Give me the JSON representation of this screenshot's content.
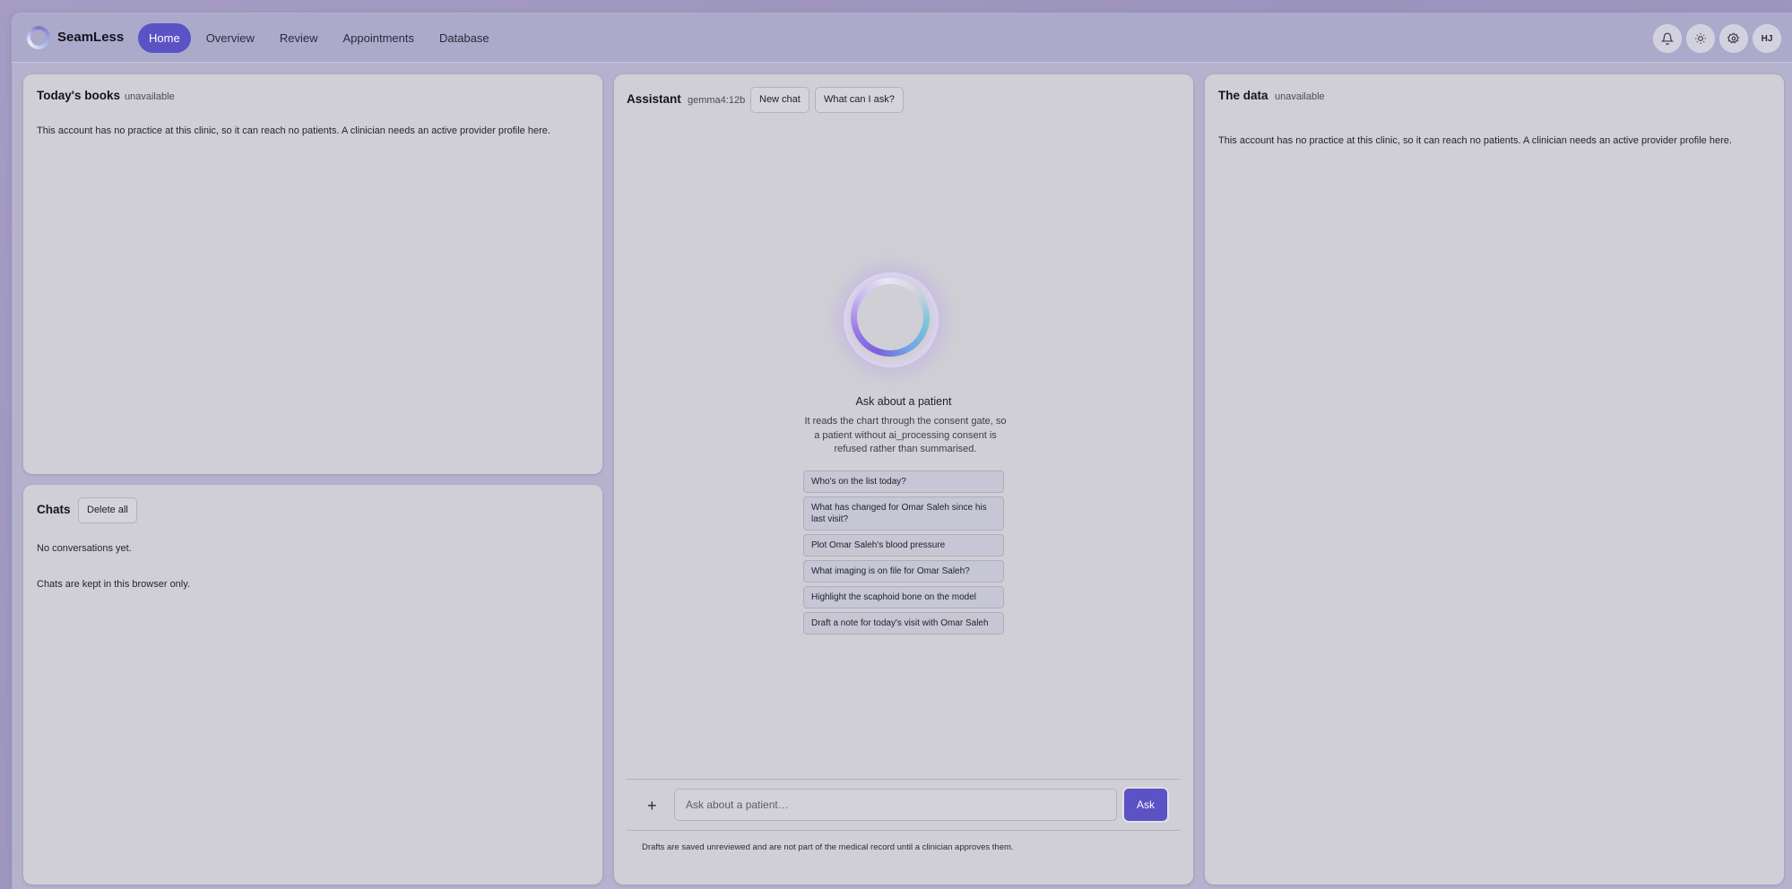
{
  "brand": {
    "name": "SeamLess"
  },
  "nav": {
    "items": [
      {
        "label": "Home"
      },
      {
        "label": "Overview"
      },
      {
        "label": "Review"
      },
      {
        "label": "Appointments"
      },
      {
        "label": "Database"
      }
    ],
    "active": "Home"
  },
  "toolbar": {
    "avatar_initials": "HJ"
  },
  "books": {
    "title": "Today's books",
    "status": "unavailable",
    "message": "This account has no practice at this clinic, so it can reach no patients. A clinician needs an active provider profile here."
  },
  "chats": {
    "title": "Chats",
    "delete_label": "Delete all",
    "empty": "No conversations yet.",
    "note": "Chats are kept in this browser only."
  },
  "assistant": {
    "title": "Assistant",
    "model": "gemma4:12b",
    "new_chat_label": "New chat",
    "what_label": "What can I ask?",
    "hero_title": "Ask about a patient",
    "hero_desc": "It reads the chart through the consent gate, so a patient without ai_processing consent is refused rather than summarised.",
    "suggestions": [
      "Who's on the list today?",
      "What has changed for Omar Saleh since his last visit?",
      "Plot Omar Saleh's blood pressure",
      "What imaging is on file for Omar Saleh?",
      "Highlight the scaphoid bone on the model",
      "Draft a note for today's visit with Omar Saleh"
    ],
    "input_placeholder": "Ask about a patient…",
    "ask_label": "Ask",
    "footnote": "Drafts are saved unreviewed and are not part of the medical record until a clinician approves them."
  },
  "data_panel": {
    "title": "The data",
    "status": "unavailable",
    "message": "This account has no practice at this clinic, so it can reach no patients. A clinician needs an active provider profile here."
  },
  "colors": {
    "accent": "#5b52c6",
    "panel": "#d0cfd5",
    "background": "#a59cc4"
  }
}
